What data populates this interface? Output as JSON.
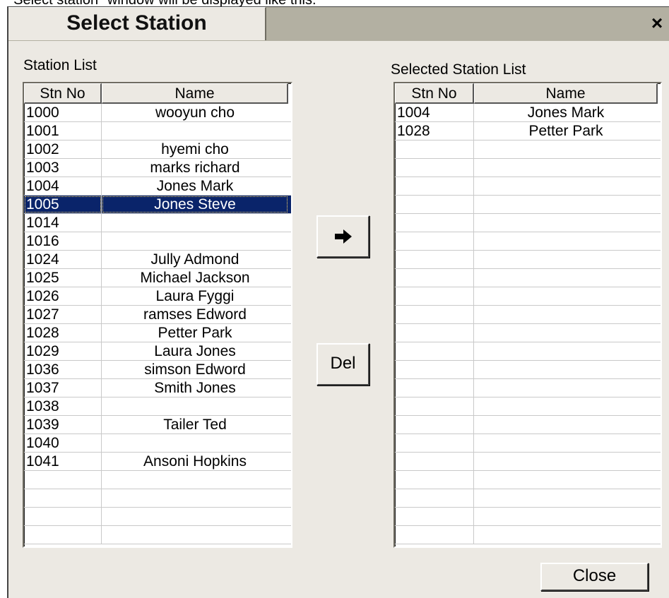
{
  "caption": "\"Select station\" window will be displayed like this.",
  "window": {
    "title": "Select Station",
    "close_glyph": "×"
  },
  "left": {
    "label": "Station List",
    "columns": [
      "Stn No",
      "Name"
    ],
    "rows": [
      {
        "no": "1000",
        "name": "wooyun cho"
      },
      {
        "no": "1001",
        "name": ""
      },
      {
        "no": "1002",
        "name": "hyemi cho"
      },
      {
        "no": "1003",
        "name": "marks richard"
      },
      {
        "no": "1004",
        "name": "Jones Mark"
      },
      {
        "no": "1005",
        "name": "Jones Steve",
        "selected": true
      },
      {
        "no": "1014",
        "name": ""
      },
      {
        "no": "1016",
        "name": ""
      },
      {
        "no": "1024",
        "name": "Jully Admond"
      },
      {
        "no": "1025",
        "name": "Michael Jackson"
      },
      {
        "no": "1026",
        "name": "Laura Fyggi"
      },
      {
        "no": "1027",
        "name": "ramses Edword"
      },
      {
        "no": "1028",
        "name": "Petter Park"
      },
      {
        "no": "1029",
        "name": "Laura Jones"
      },
      {
        "no": "1036",
        "name": "simson Edword"
      },
      {
        "no": "1037",
        "name": "Smith Jones"
      },
      {
        "no": "1038",
        "name": ""
      },
      {
        "no": "1039",
        "name": "Tailer Ted"
      },
      {
        "no": "1040",
        "name": ""
      },
      {
        "no": "1041",
        "name": "Ansoni Hopkins"
      },
      {
        "no": "",
        "name": ""
      },
      {
        "no": "",
        "name": ""
      },
      {
        "no": "",
        "name": ""
      },
      {
        "no": "",
        "name": ""
      }
    ]
  },
  "right": {
    "label": "Selected Station List",
    "columns": [
      "Stn No",
      "Name"
    ],
    "rows": [
      {
        "no": "1004",
        "name": "Jones Mark"
      },
      {
        "no": "1028",
        "name": "Petter Park"
      },
      {
        "no": "",
        "name": ""
      },
      {
        "no": "",
        "name": ""
      },
      {
        "no": "",
        "name": ""
      },
      {
        "no": "",
        "name": ""
      },
      {
        "no": "",
        "name": ""
      },
      {
        "no": "",
        "name": ""
      },
      {
        "no": "",
        "name": ""
      },
      {
        "no": "",
        "name": ""
      },
      {
        "no": "",
        "name": ""
      },
      {
        "no": "",
        "name": ""
      },
      {
        "no": "",
        "name": ""
      },
      {
        "no": "",
        "name": ""
      },
      {
        "no": "",
        "name": ""
      },
      {
        "no": "",
        "name": ""
      },
      {
        "no": "",
        "name": ""
      },
      {
        "no": "",
        "name": ""
      },
      {
        "no": "",
        "name": ""
      },
      {
        "no": "",
        "name": ""
      },
      {
        "no": "",
        "name": ""
      },
      {
        "no": "",
        "name": ""
      },
      {
        "no": "",
        "name": ""
      },
      {
        "no": "",
        "name": ""
      }
    ]
  },
  "buttons": {
    "add_icon": "arrow-right-icon",
    "del_label": "Del",
    "close_label": "Close"
  },
  "colors": {
    "selection": "#0a246a",
    "dialog_bg": "#ece9e3"
  }
}
